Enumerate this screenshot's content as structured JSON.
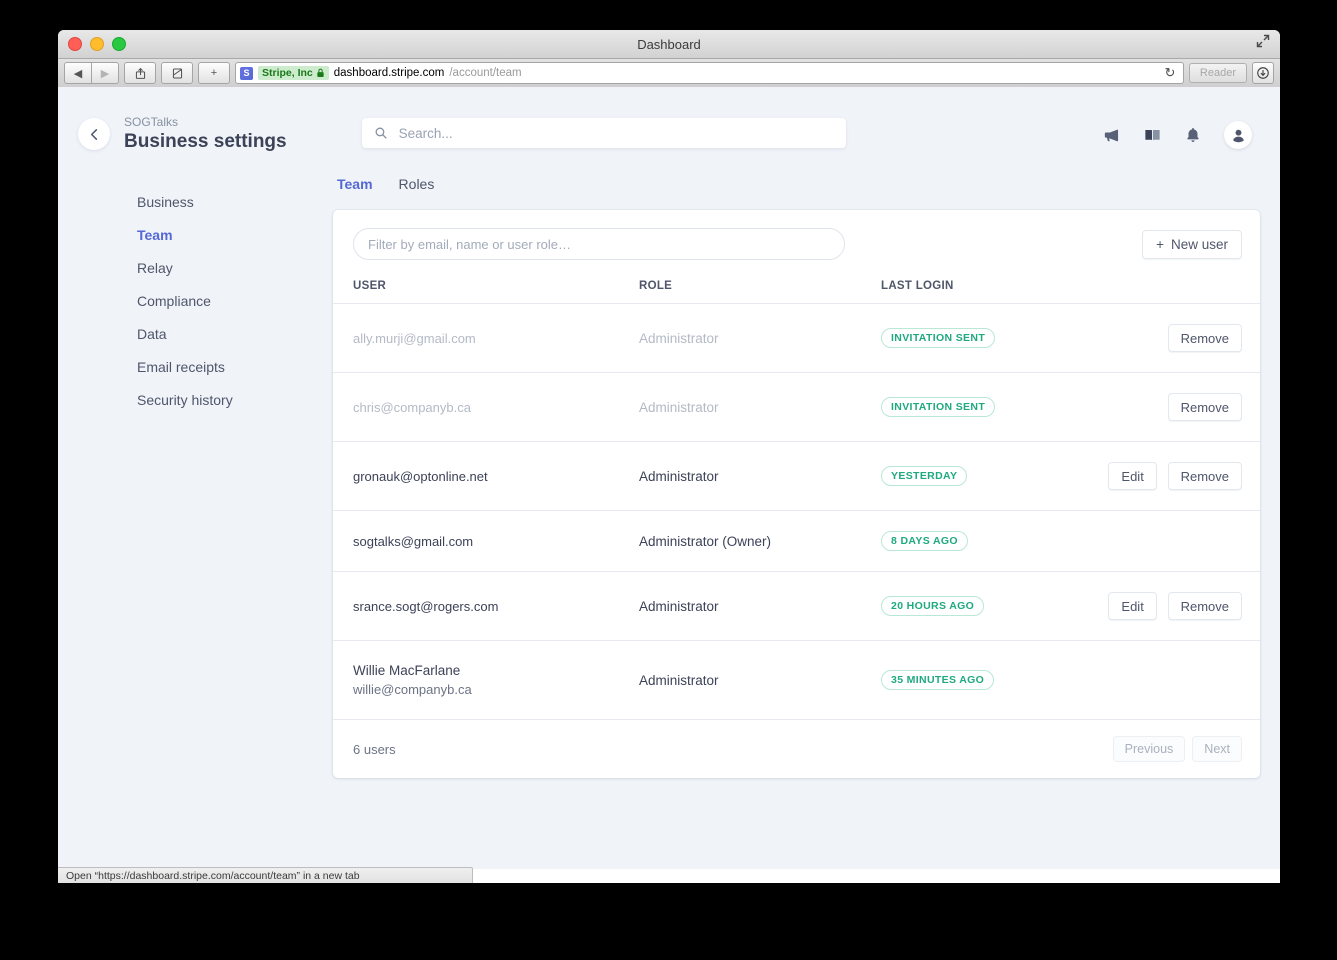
{
  "window": {
    "title": "Dashboard",
    "traffic_lights": [
      "close",
      "minimize",
      "zoom"
    ],
    "fullscreen_label": "Enter Full Screen"
  },
  "browser": {
    "back_label": "◀",
    "forward_label": "▶",
    "share_label": "share-icon",
    "sidebar_label": "reading-list-icon",
    "newtab_label": "+",
    "favicon_letter": "S",
    "ev_certificate": "Stripe, Inc",
    "lock": "🔒",
    "url_domain": "dashboard.stripe.com",
    "url_path": "/account/team",
    "reload_label": "↻",
    "reader_label": "Reader",
    "downloads_label": "downloads-icon"
  },
  "header": {
    "breadcrumb": "SOGTalks",
    "title": "Business settings",
    "back_arrow": "←"
  },
  "search": {
    "placeholder": "Search...",
    "value": "",
    "icon": "search-icon"
  },
  "header_icons": [
    {
      "name": "announcements-icon",
      "label": "Announcements"
    },
    {
      "name": "docs-icon",
      "label": "Documentation"
    },
    {
      "name": "notifications-icon",
      "label": "Notifications"
    },
    {
      "name": "account-avatar",
      "label": "Account"
    }
  ],
  "sidebar": {
    "items": [
      {
        "label": "Business",
        "active": false
      },
      {
        "label": "Team",
        "active": true
      },
      {
        "label": "Relay",
        "active": false
      },
      {
        "label": "Compliance",
        "active": false
      },
      {
        "label": "Data",
        "active": false
      },
      {
        "label": "Email receipts",
        "active": false
      },
      {
        "label": "Security history",
        "active": false
      }
    ]
  },
  "tabs": [
    {
      "label": "Team",
      "active": true
    },
    {
      "label": "Roles",
      "active": false
    }
  ],
  "toolbar": {
    "filter_placeholder": "Filter by email, name or user role…",
    "filter_value": "",
    "new_user_label": "New user",
    "new_user_icon": "+"
  },
  "table": {
    "columns": [
      "USER",
      "ROLE",
      "LAST LOGIN",
      ""
    ],
    "rows": [
      {
        "name": "",
        "email": "ally.murji@gmail.com",
        "role": "Administrator",
        "last_login": "INVITATION SENT",
        "pending": true,
        "actions": [
          "Remove"
        ]
      },
      {
        "name": "",
        "email": "chris@companyb.ca",
        "role": "Administrator",
        "last_login": "INVITATION SENT",
        "pending": true,
        "actions": [
          "Remove"
        ]
      },
      {
        "name": "",
        "email": "gronauk@optonline.net",
        "role": "Administrator",
        "last_login": "YESTERDAY",
        "pending": false,
        "actions": [
          "Edit",
          "Remove"
        ]
      },
      {
        "name": "",
        "email": "sogtalks@gmail.com",
        "role": "Administrator (Owner)",
        "last_login": "8 DAYS AGO",
        "pending": false,
        "actions": []
      },
      {
        "name": "",
        "email": "srance.sogt@rogers.com",
        "role": "Administrator",
        "last_login": "20 HOURS AGO",
        "pending": false,
        "actions": [
          "Edit",
          "Remove"
        ]
      },
      {
        "name": "Willie MacFarlane",
        "email": "willie@companyb.ca",
        "role": "Administrator",
        "last_login": "35 MINUTES AGO",
        "pending": false,
        "actions": []
      }
    ]
  },
  "footer": {
    "count_label": "6 users",
    "previous_label": "Previous",
    "next_label": "Next"
  },
  "statusbar": {
    "text": "Open “https://dashboard.stripe.com/account/team” in a new tab"
  },
  "colors": {
    "accent": "#5469d4",
    "badge_green": "#1fa97f",
    "badge_border": "#b9e8d6",
    "page_bg": "#f0f3f8",
    "text": "#3c4257",
    "muted": "#b3bac6"
  }
}
